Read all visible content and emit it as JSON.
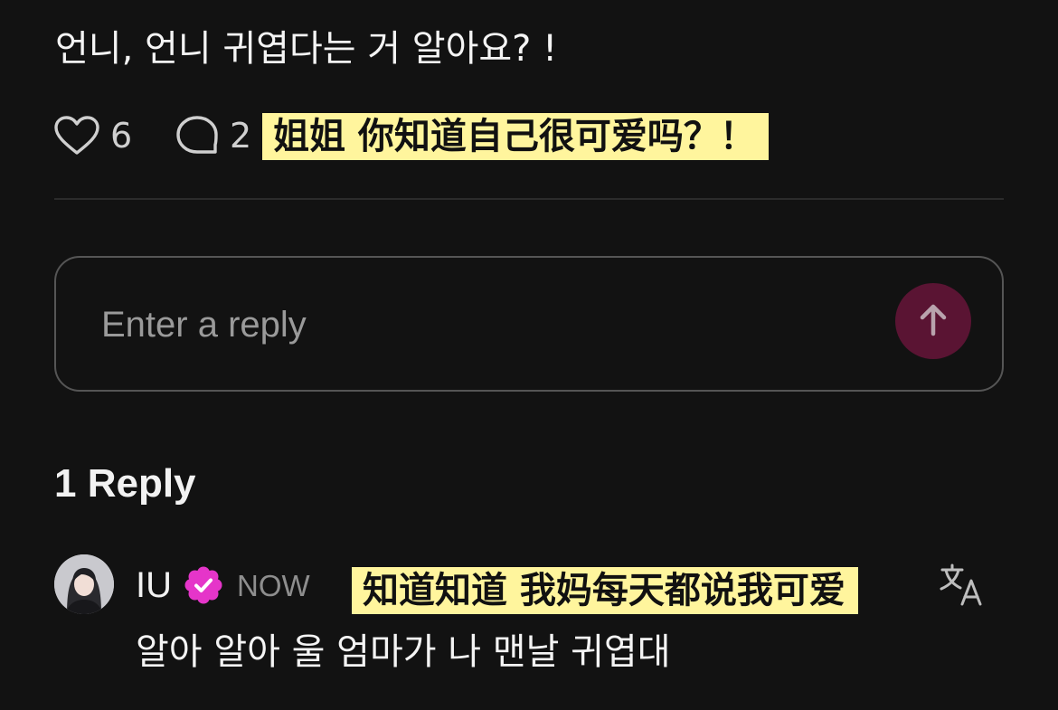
{
  "post": {
    "text": "언니, 언니 귀엽다는 거 알아요? !",
    "like_count": "6",
    "comment_count": "2",
    "translation": "姐姐 你知道自己很可爱吗？！"
  },
  "reply_input": {
    "placeholder": "Enter a reply"
  },
  "replies": {
    "heading": "1 Reply",
    "items": [
      {
        "author": "IU",
        "time": "NOW",
        "text": "알아 알아 울 엄마가 나 맨날 귀엽대",
        "translation": "知道知道 我妈每天都说我可爱"
      }
    ]
  },
  "icons": {
    "like": "heart-outline-icon",
    "comment": "speech-bubble-icon",
    "send": "arrow-up-icon",
    "verified": "verified-badge-icon",
    "translate": "translate-icon"
  },
  "colors": {
    "background": "#121212",
    "highlight": "#fff59d",
    "send_button": "#5a1433",
    "verified": "#e535c9"
  }
}
